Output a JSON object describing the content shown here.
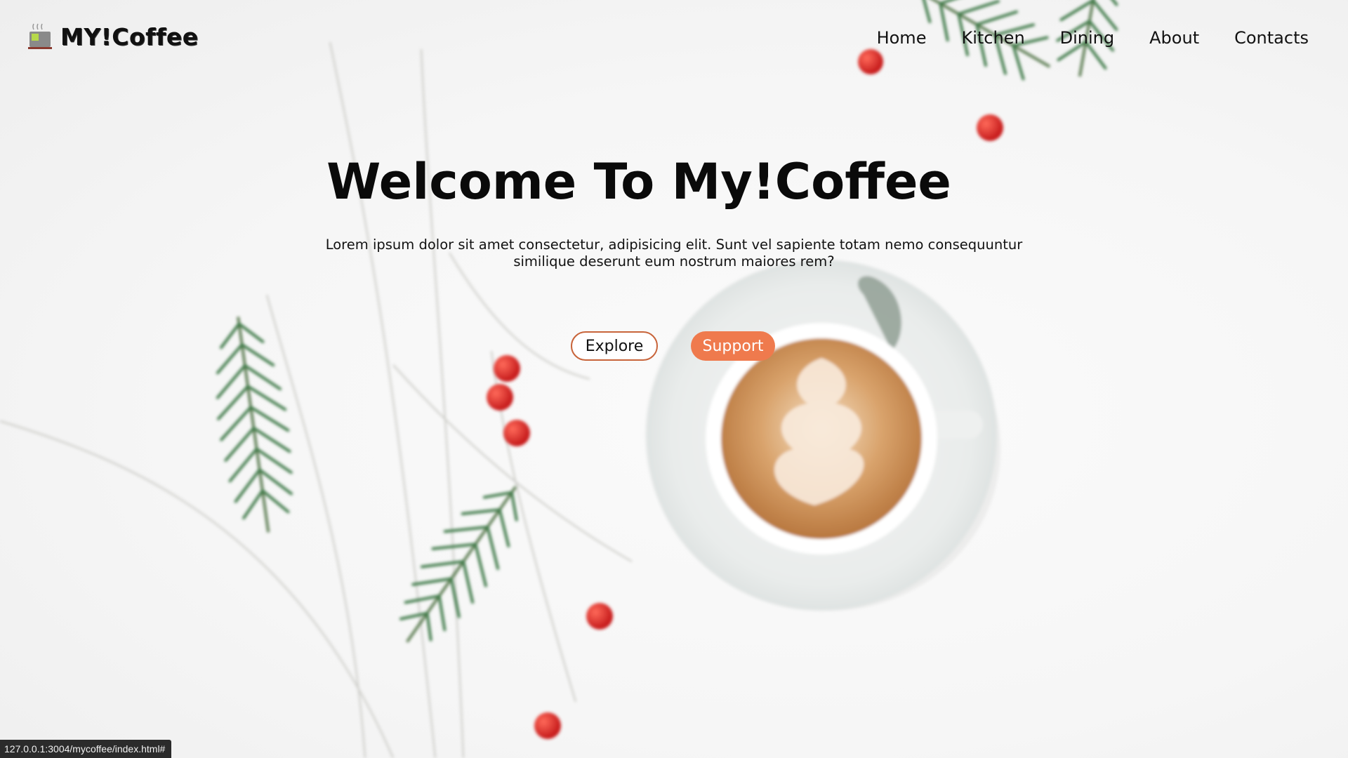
{
  "logo": {
    "text": "MY!Coffee",
    "icon": "coffee-cup-icon"
  },
  "nav": {
    "items": [
      {
        "label": "Home"
      },
      {
        "label": "Kitchen"
      },
      {
        "label": "Dining"
      },
      {
        "label": "About"
      },
      {
        "label": "Contacts"
      }
    ]
  },
  "hero": {
    "title": "Welcome To My!Coffee",
    "text": "Lorem ipsum dolor sit amet consectetur, adipisicing elit. Sunt vel sapiente totam nemo consequuntur similique deserunt eum nostrum maiores rem?",
    "explore_label": "Explore",
    "support_label": "Support"
  },
  "status_bar": {
    "url": "127.0.0.1:3004/mycoffee/index.html#"
  },
  "colors": {
    "accent": "#ef7a4d",
    "explore_border": "#c8643a",
    "text": "#111111"
  }
}
